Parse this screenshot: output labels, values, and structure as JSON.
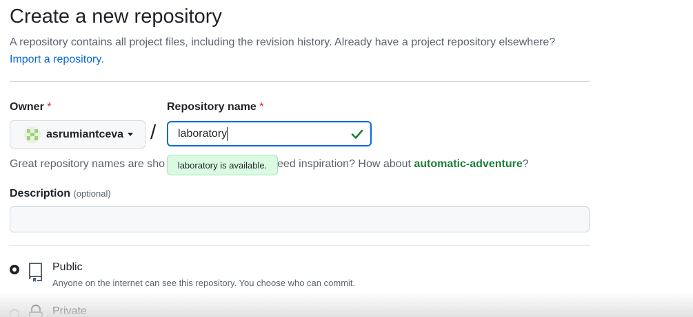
{
  "page": {
    "title": "Create a new repository",
    "intro_text": "A repository contains all project files, including the revision history. Already have a project repository elsewhere?",
    "import_link": "Import a repository."
  },
  "owner": {
    "label": "Owner",
    "required_mark": "*",
    "value": "asrumiantceva"
  },
  "separator": "/",
  "repository_name": {
    "label": "Repository name",
    "required_mark": "*",
    "value": "laboratory",
    "availability": "laboratory is available."
  },
  "name_hint": {
    "prefix": "Great repository names are sho",
    "middle": "eed inspiration? How about ",
    "suggestion": "automatic-adventure",
    "suffix": "?"
  },
  "description": {
    "label": "Description",
    "optional": "(optional)",
    "value": ""
  },
  "visibility": {
    "options": [
      {
        "label": "Public",
        "description": "Anyone on the internet can see this repository. You choose who can commit.",
        "selected": true
      },
      {
        "label": "Private",
        "selected": false
      }
    ]
  },
  "colors": {
    "accent": "#0969da",
    "success": "#1a7f37",
    "required": "#d1242f"
  }
}
